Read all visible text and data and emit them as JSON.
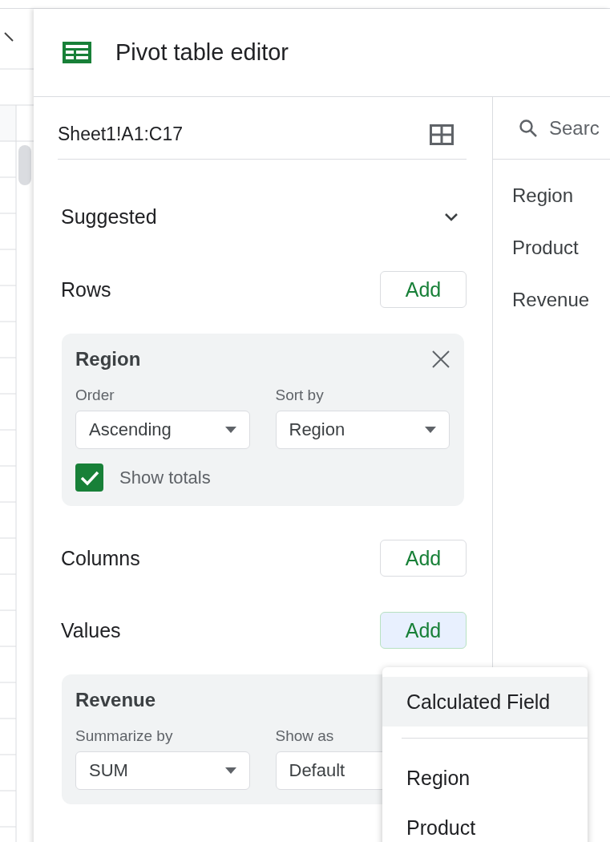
{
  "header": {
    "title": "Pivot table editor"
  },
  "range": {
    "value": "Sheet1!A1:C17"
  },
  "suggested": {
    "label": "Suggested",
    "expanded": false
  },
  "sections": [
    {
      "label": "Rows",
      "add": {
        "label": "Add",
        "active": false
      },
      "cards": [
        {
          "title": "Region",
          "closable": true,
          "dropdowns": [
            {
              "label": "Order",
              "value": "Ascending",
              "caret": true
            },
            {
              "label": "Sort by",
              "value": "Region",
              "caret": true
            }
          ],
          "show_totals": {
            "label": "Show totals",
            "checked": true
          }
        }
      ]
    },
    {
      "label": "Columns",
      "add": {
        "label": "Add",
        "active": false
      }
    },
    {
      "label": "Values",
      "add": {
        "label": "Add",
        "active": true
      },
      "cards": [
        {
          "title": "Revenue",
          "closable": false,
          "dropdowns": [
            {
              "label": "Summarize by",
              "value": "SUM",
              "caret": true
            },
            {
              "label": "Show as",
              "value": "Default",
              "caret": false
            }
          ]
        }
      ]
    }
  ],
  "fields": {
    "placeholder": "Searc",
    "items": [
      "Region",
      "Product",
      "Revenue"
    ]
  },
  "menu": {
    "items": [
      {
        "kind": "option",
        "label": "Calculated Field",
        "selected": true
      },
      {
        "kind": "divider"
      },
      {
        "kind": "option",
        "label": "Region",
        "selected": false
      },
      {
        "kind": "option",
        "label": "Product",
        "selected": false
      }
    ]
  }
}
